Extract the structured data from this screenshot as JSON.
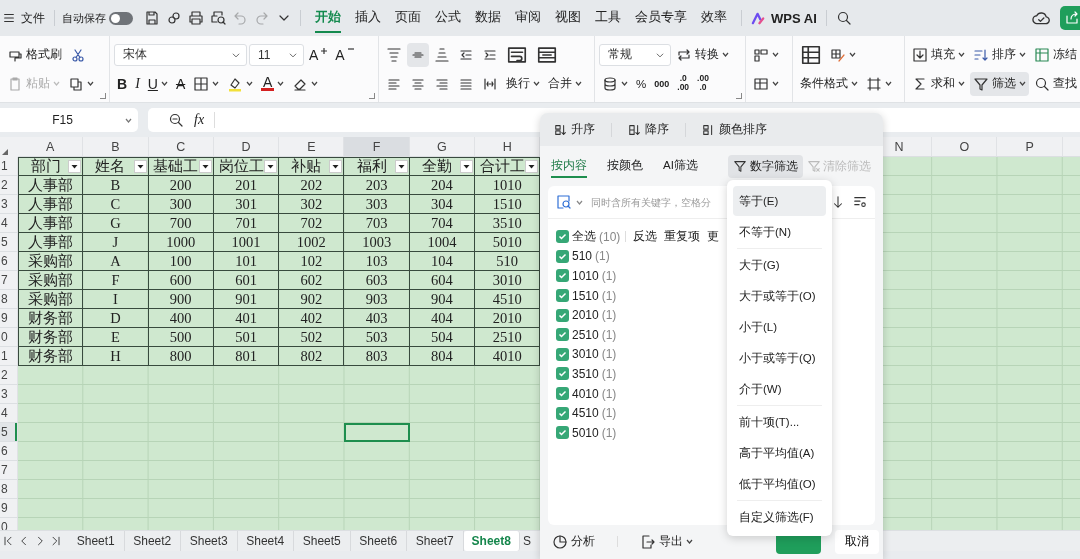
{
  "menubar": {
    "file": {
      "label": "文件"
    },
    "autosave": {
      "label": "自动保存",
      "on": false
    },
    "quick_tools": [
      {
        "kind": "save",
        "disabled": false
      },
      {
        "kind": "link",
        "disabled": false
      },
      {
        "kind": "print",
        "disabled": false
      },
      {
        "kind": "preview",
        "disabled": false
      },
      {
        "kind": "undo",
        "disabled": true
      },
      {
        "kind": "redo",
        "disabled": true
      },
      {
        "kind": "more",
        "disabled": false
      }
    ],
    "tabs": [
      {
        "label": "开始",
        "selected": true
      },
      {
        "label": "插入",
        "selected": false
      },
      {
        "label": "页面",
        "selected": false
      },
      {
        "label": "公式",
        "selected": false
      },
      {
        "label": "数据",
        "selected": false
      },
      {
        "label": "审阅",
        "selected": false
      },
      {
        "label": "视图",
        "selected": false
      },
      {
        "label": "工具",
        "selected": false
      },
      {
        "label": "会员专享",
        "selected": false
      },
      {
        "label": "效率",
        "selected": false
      }
    ],
    "ai": {
      "label": "WPS AI"
    }
  },
  "ribbon": {
    "groups": [
      {
        "launcher": true,
        "top": [
          {
            "kind": "brush",
            "label": "格式刷"
          },
          {
            "kind": "cut"
          }
        ],
        "bottom": [
          {
            "kind": "paste",
            "label": "粘贴",
            "caret": true,
            "disabled": true
          },
          {
            "kind": "copy",
            "caret": true
          }
        ]
      },
      {
        "launcher": true,
        "top": [
          {
            "kind": "font",
            "value": "宋体"
          },
          {
            "kind": "size",
            "value": "11"
          },
          {
            "kind": "grow",
            "label": "A"
          },
          {
            "kind": "shrink",
            "label": "A"
          }
        ],
        "bottom": [
          {
            "kind": "bold",
            "label": "B"
          },
          {
            "kind": "italic",
            "label": "I"
          },
          {
            "kind": "underline",
            "label": "U",
            "caret": true
          },
          {
            "kind": "strike",
            "label": "A"
          },
          {
            "kind": "borders",
            "caret": true
          },
          {
            "kind": "highlight",
            "caret": true
          },
          {
            "kind": "fontcolor",
            "label": "A",
            "caret": true
          },
          {
            "kind": "eraser",
            "caret": true
          }
        ]
      },
      {
        "top": [
          {
            "kind": "align-top",
            "selected": false
          },
          {
            "kind": "align-middle",
            "selected": true
          },
          {
            "kind": "align-bottom",
            "selected": false
          },
          {
            "kind": "outdent"
          },
          {
            "kind": "indent"
          },
          {
            "kind": "wrap"
          },
          {
            "kind": "merge"
          }
        ],
        "bottom": [
          {
            "kind": "align-left",
            "selected": false
          },
          {
            "kind": "align-center",
            "selected": false
          },
          {
            "kind": "align-right",
            "selected": false
          },
          {
            "kind": "justify",
            "selected": false
          },
          {
            "kind": "distribute",
            "selected": false
          },
          {
            "kind": "text",
            "label": "换行",
            "caret": true
          },
          {
            "kind": "text",
            "label": "合并",
            "caret": true
          }
        ]
      },
      {
        "launcher": true,
        "top": [
          {
            "kind": "select",
            "value": "常规"
          },
          {
            "kind": "convert",
            "label": "转换",
            "caret": true
          }
        ],
        "bottom": [
          {
            "kind": "database",
            "caret": true
          },
          {
            "kind": "text",
            "label": "%"
          },
          {
            "kind": "thousands",
            "label": "000"
          },
          {
            "kind": "decimal",
            "top": ".0",
            "bottom": ".00"
          },
          {
            "kind": "decimal",
            "top": ".00",
            "bottom": ".0"
          }
        ]
      },
      {
        "top": [
          {
            "kind": "cells",
            "caret": true
          }
        ],
        "bottom": [
          {
            "kind": "table",
            "caret": true
          }
        ]
      },
      {
        "top": [
          {
            "kind": "conditional"
          },
          {
            "kind": "style",
            "caret": true
          }
        ],
        "bottom": [
          {
            "kind": "text",
            "label": "条件格式",
            "caret": true
          },
          {
            "kind": "frame",
            "caret": true
          }
        ]
      },
      {
        "top": [
          {
            "kind": "fill",
            "label": "填充",
            "caret": true,
            "selected": false
          },
          {
            "kind": "sort",
            "label": "排序",
            "caret": true,
            "selected": false
          },
          {
            "kind": "freeze",
            "label": "冻结",
            "selected": false
          }
        ],
        "bottom": [
          {
            "kind": "sum",
            "label": "求和",
            "caret": true,
            "selected": false
          },
          {
            "kind": "filter",
            "label": "筛选",
            "caret": true,
            "selected": true
          },
          {
            "kind": "find",
            "label": "查找",
            "selected": false
          }
        ]
      }
    ]
  },
  "formula_bar": {
    "cell": "F15",
    "fx": "fx"
  },
  "sheet": {
    "columns": [
      {
        "letter": "A",
        "selected": false
      },
      {
        "letter": "B",
        "selected": false
      },
      {
        "letter": "C",
        "selected": false
      },
      {
        "letter": "D",
        "selected": false
      },
      {
        "letter": "E",
        "selected": false
      },
      {
        "letter": "F",
        "selected": true
      },
      {
        "letter": "G",
        "selected": false
      },
      {
        "letter": "H",
        "selected": false
      }
    ],
    "right_columns": [
      "N",
      "O",
      "P"
    ],
    "rows": [
      {
        "number": "1",
        "selected": false
      },
      {
        "number": "2",
        "selected": false
      },
      {
        "number": "3",
        "selected": false
      },
      {
        "number": "4",
        "selected": false
      },
      {
        "number": "5",
        "selected": false
      },
      {
        "number": "6",
        "selected": false
      },
      {
        "number": "7",
        "selected": false
      },
      {
        "number": "8",
        "selected": false
      },
      {
        "number": "9",
        "selected": false
      },
      {
        "number": "0",
        "selected": false
      },
      {
        "number": "1",
        "selected": false
      },
      {
        "number": "2",
        "selected": false
      },
      {
        "number": "3",
        "selected": false
      },
      {
        "number": "4",
        "selected": false
      },
      {
        "number": "5",
        "selected": true
      },
      {
        "number": "6",
        "selected": false
      },
      {
        "number": "7",
        "selected": false
      },
      {
        "number": "8",
        "selected": false
      },
      {
        "number": "9",
        "selected": false
      },
      {
        "number": "0",
        "selected": false
      }
    ],
    "headers": [
      "部门",
      "姓名",
      "基础工",
      "岗位工",
      "补贴",
      "福利",
      "全勤",
      "合计工"
    ],
    "data": [
      [
        "人事部",
        "B",
        "200",
        "201",
        "202",
        "203",
        "204",
        "1010"
      ],
      [
        "人事部",
        "C",
        "300",
        "301",
        "302",
        "303",
        "304",
        "1510"
      ],
      [
        "人事部",
        "G",
        "700",
        "701",
        "702",
        "703",
        "704",
        "3510"
      ],
      [
        "人事部",
        "J",
        "1000",
        "1001",
        "1002",
        "1003",
        "1004",
        "5010"
      ],
      [
        "采购部",
        "A",
        "100",
        "101",
        "102",
        "103",
        "104",
        "510"
      ],
      [
        "采购部",
        "F",
        "600",
        "601",
        "602",
        "603",
        "604",
        "3010"
      ],
      [
        "采购部",
        "I",
        "900",
        "901",
        "902",
        "903",
        "904",
        "4510"
      ],
      [
        "财务部",
        "D",
        "400",
        "401",
        "402",
        "403",
        "404",
        "2010"
      ],
      [
        "财务部",
        "E",
        "500",
        "501",
        "502",
        "503",
        "504",
        "2510"
      ],
      [
        "财务部",
        "H",
        "800",
        "801",
        "802",
        "803",
        "804",
        "4010"
      ]
    ]
  },
  "sheet_tabs": [
    {
      "label": "Sheet1",
      "selected": false
    },
    {
      "label": "Sheet2",
      "selected": false
    },
    {
      "label": "Sheet3",
      "selected": false
    },
    {
      "label": "Sheet4",
      "selected": false
    },
    {
      "label": "Sheet5",
      "selected": false
    },
    {
      "label": "Sheet6",
      "selected": false
    },
    {
      "label": "Sheet7",
      "selected": false
    },
    {
      "label": "Sheet8",
      "selected": true
    },
    {
      "label": "S",
      "selected": false
    }
  ],
  "filter_panel": {
    "sort": [
      {
        "kind": "asc",
        "label": "升序"
      },
      {
        "kind": "desc",
        "label": "降序"
      },
      {
        "kind": "color",
        "label": "颜色排序"
      }
    ],
    "tabs": [
      {
        "label": "按内容",
        "selected": true
      },
      {
        "label": "按颜色",
        "selected": false
      },
      {
        "label": "AI筛选",
        "selected": false
      }
    ],
    "number_filter": {
      "label": "数字筛选",
      "open": true
    },
    "clear": {
      "label": "清除筛选",
      "disabled": true
    },
    "search": {
      "placeholder": "同时含所有关键字，空格分"
    },
    "select_all": {
      "label": "全选",
      "count": "(10)",
      "checked": true
    },
    "actions": [
      "反选",
      "重复项",
      "更"
    ],
    "values": [
      {
        "value": "510",
        "count": "(1)",
        "checked": true
      },
      {
        "value": "1010",
        "count": "(1)",
        "checked": true
      },
      {
        "value": "1510",
        "count": "(1)",
        "checked": true
      },
      {
        "value": "2010",
        "count": "(1)",
        "checked": true
      },
      {
        "value": "2510",
        "count": "(1)",
        "checked": true
      },
      {
        "value": "3010",
        "count": "(1)",
        "checked": true
      },
      {
        "value": "3510",
        "count": "(1)",
        "checked": true
      },
      {
        "value": "4010",
        "count": "(1)",
        "checked": true
      },
      {
        "value": "4510",
        "count": "(1)",
        "checked": true
      },
      {
        "value": "5010",
        "count": "(1)",
        "checked": true
      }
    ],
    "footer": {
      "analyze": "分析",
      "export": "导出",
      "cancel": "取消"
    }
  },
  "number_menu": {
    "groups": [
      [
        {
          "label": "等于(E)",
          "selected": true
        },
        {
          "label": "不等于(N)",
          "selected": false
        }
      ],
      [
        {
          "label": "大于(G)",
          "selected": false
        },
        {
          "label": "大于或等于(O)",
          "selected": false
        },
        {
          "label": "小于(L)",
          "selected": false
        },
        {
          "label": "小于或等于(Q)",
          "selected": false
        },
        {
          "label": "介于(W)",
          "selected": false
        }
      ],
      [
        {
          "label": "前十项(T)...",
          "selected": false
        },
        {
          "label": "高于平均值(A)",
          "selected": false
        },
        {
          "label": "低于平均值(O)",
          "selected": false
        }
      ],
      [
        {
          "label": "自定义筛选(F)",
          "selected": false
        }
      ]
    ]
  }
}
